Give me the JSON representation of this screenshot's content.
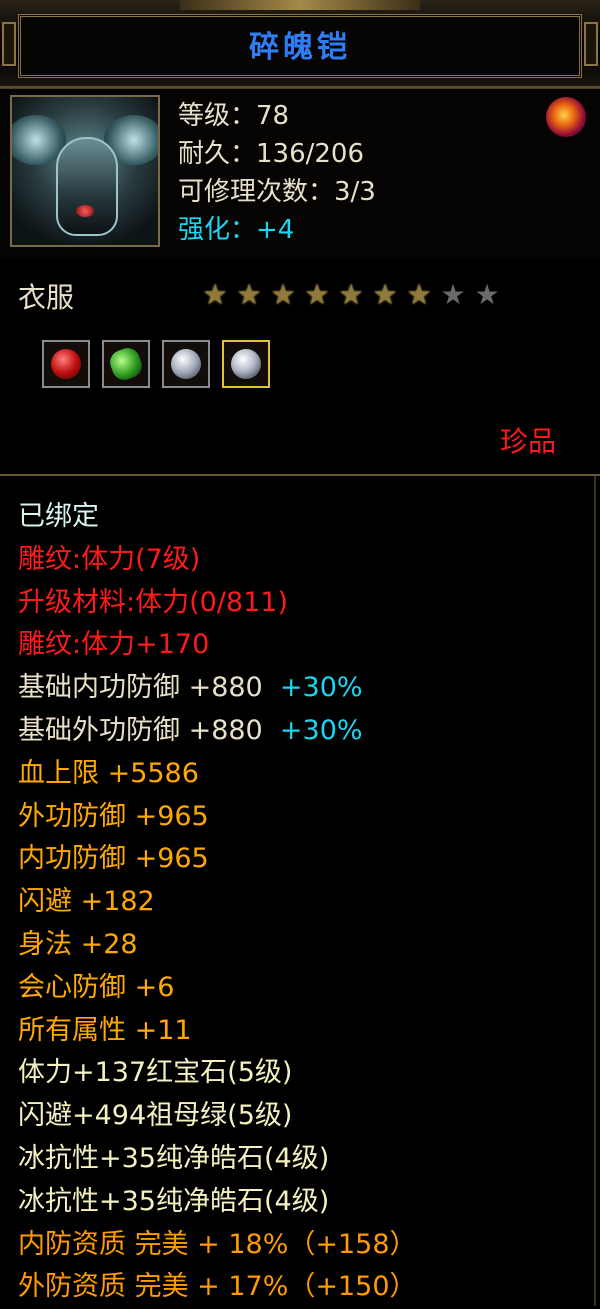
{
  "item": {
    "name": "碎魄铠",
    "level_line": "等级：78",
    "durability_line": "耐久：136/206",
    "repair_line": "可修理次数：3/3",
    "enhance_line": "强化：+4",
    "type": "衣服",
    "stars": {
      "filled": 7,
      "total": 9
    },
    "sockets": [
      "ruby-gem-icon",
      "emerald-gem-icon",
      "diamond-gem-icon",
      "diamond-gem-icon"
    ],
    "rarity": "珍品"
  },
  "attributes": {
    "bound": "已绑定",
    "carving": "雕纹:体力(7级)",
    "upgrade_material": "升级材料:体力(0/811)",
    "carving_bonus": "雕纹:体力+170",
    "base_internal_def": {
      "label": "基础内功防御 +880",
      "bonus": "+30%"
    },
    "base_external_def": {
      "label": "基础外功防御 +880",
      "bonus": "+30%"
    },
    "hp": "血上限 +5586",
    "external_def": "外功防御 +965",
    "internal_def": "内功防御 +965",
    "dodge": "闪避 +182",
    "agility": "身法 +28",
    "crit_def": "会心防御 +6",
    "all_attr": "所有属性 +11",
    "gem1": "体力+137红宝石(5级)",
    "gem2": "闪避+494祖母绿(5级)",
    "gem3": "冰抗性+35纯净皓石(4级)",
    "gem4": "冰抗性+35纯净皓石(4级)",
    "quality_internal": "内防资质 完美 + 18%（+158）",
    "quality_external": "外防资质 完美 + 17%（+150）"
  },
  "colors": {
    "title": "#2f7ef7",
    "enhance": "#19d6f5",
    "red": "#ff1a1a",
    "gold": "#ffa800",
    "cyan": "#19d6f5"
  }
}
